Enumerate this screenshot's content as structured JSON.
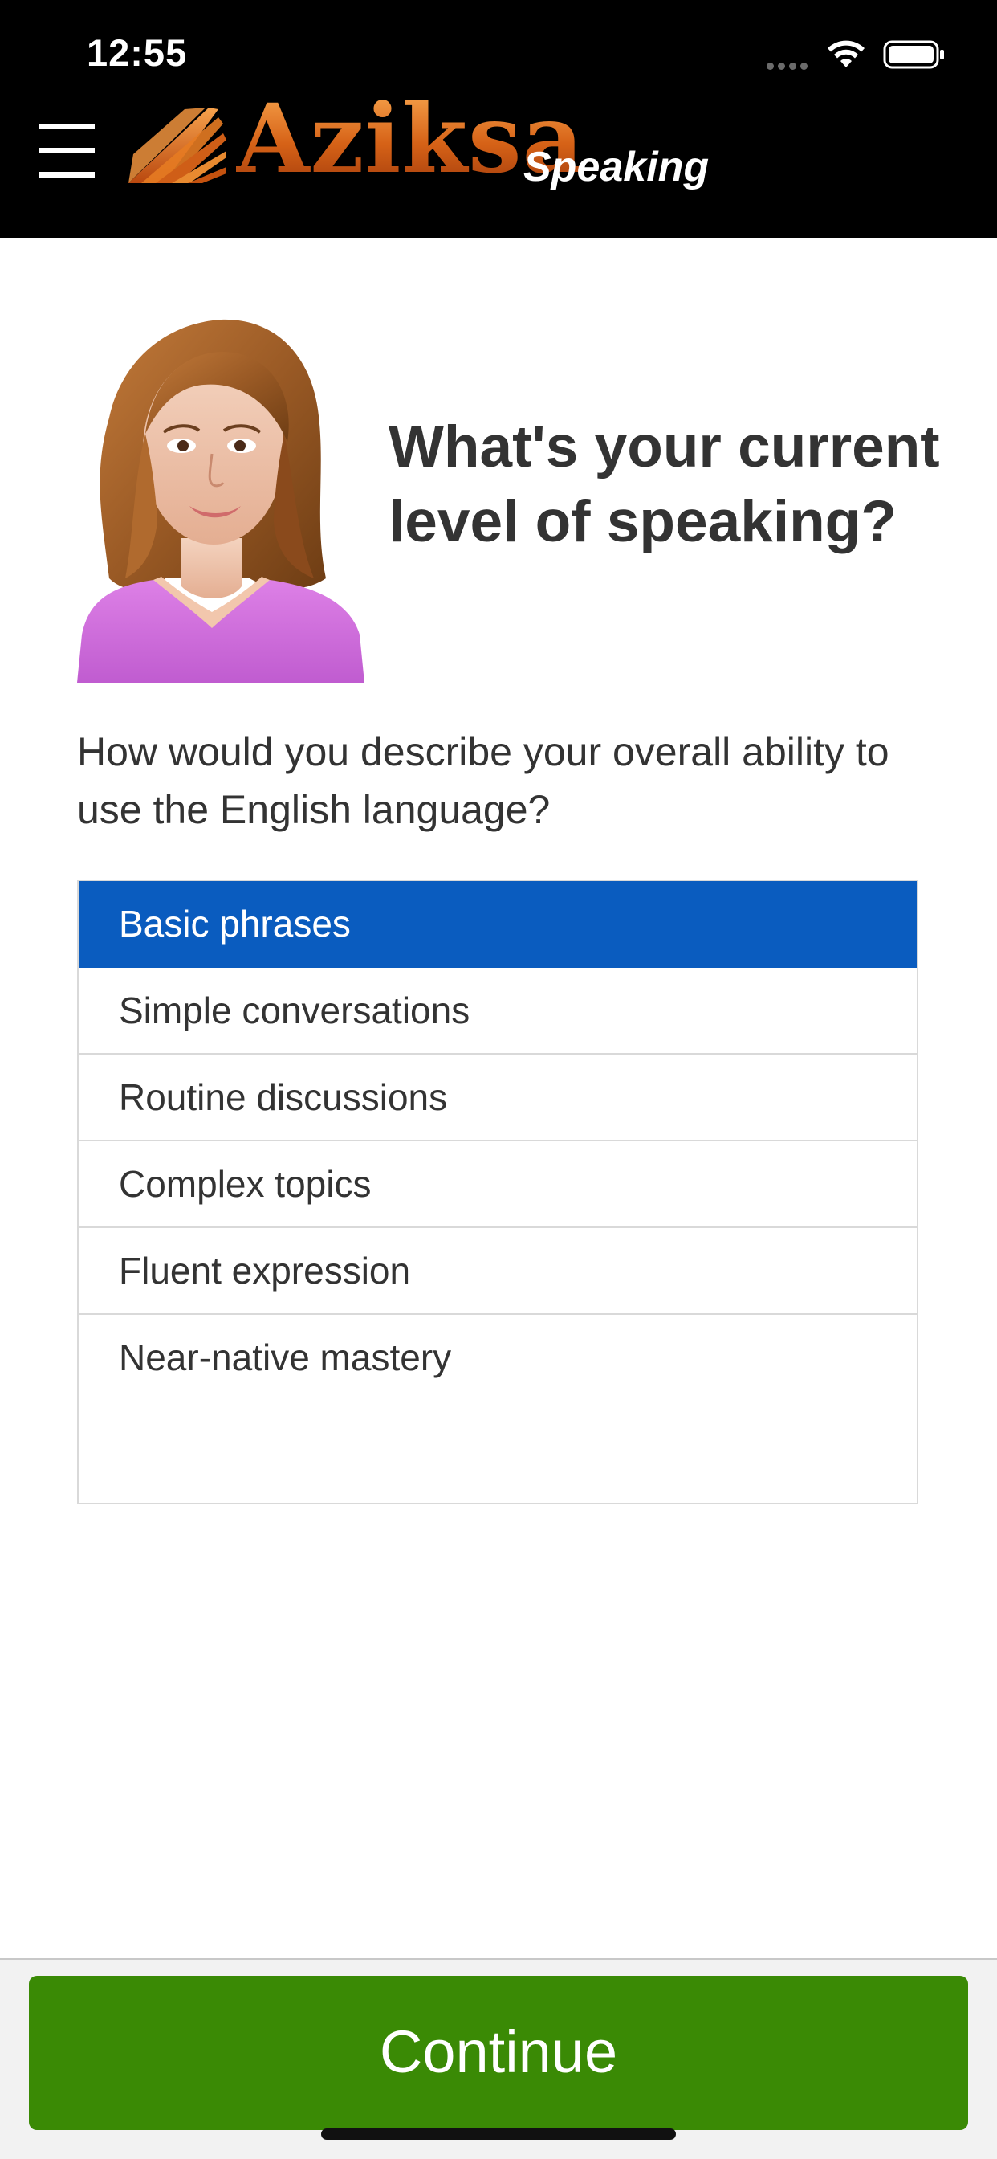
{
  "status_bar": {
    "time": "12:55"
  },
  "header": {
    "brand": "Aziksa",
    "product": "Speaking",
    "brand_color": "#d96a1c"
  },
  "question": {
    "title": "What's your current level of speaking?",
    "text": "How would you describe your overall ability to use the English language?"
  },
  "options": [
    {
      "label": "Basic phrases",
      "selected": true
    },
    {
      "label": "Simple conversations",
      "selected": false
    },
    {
      "label": "Routine discussions",
      "selected": false
    },
    {
      "label": "Complex topics",
      "selected": false
    },
    {
      "label": "Fluent expression",
      "selected": false
    },
    {
      "label": "Near-native mastery",
      "selected": false
    }
  ],
  "selected_color": "#0a5cbf",
  "footer": {
    "continue_label": "Continue",
    "button_color": "#3a8a05"
  }
}
